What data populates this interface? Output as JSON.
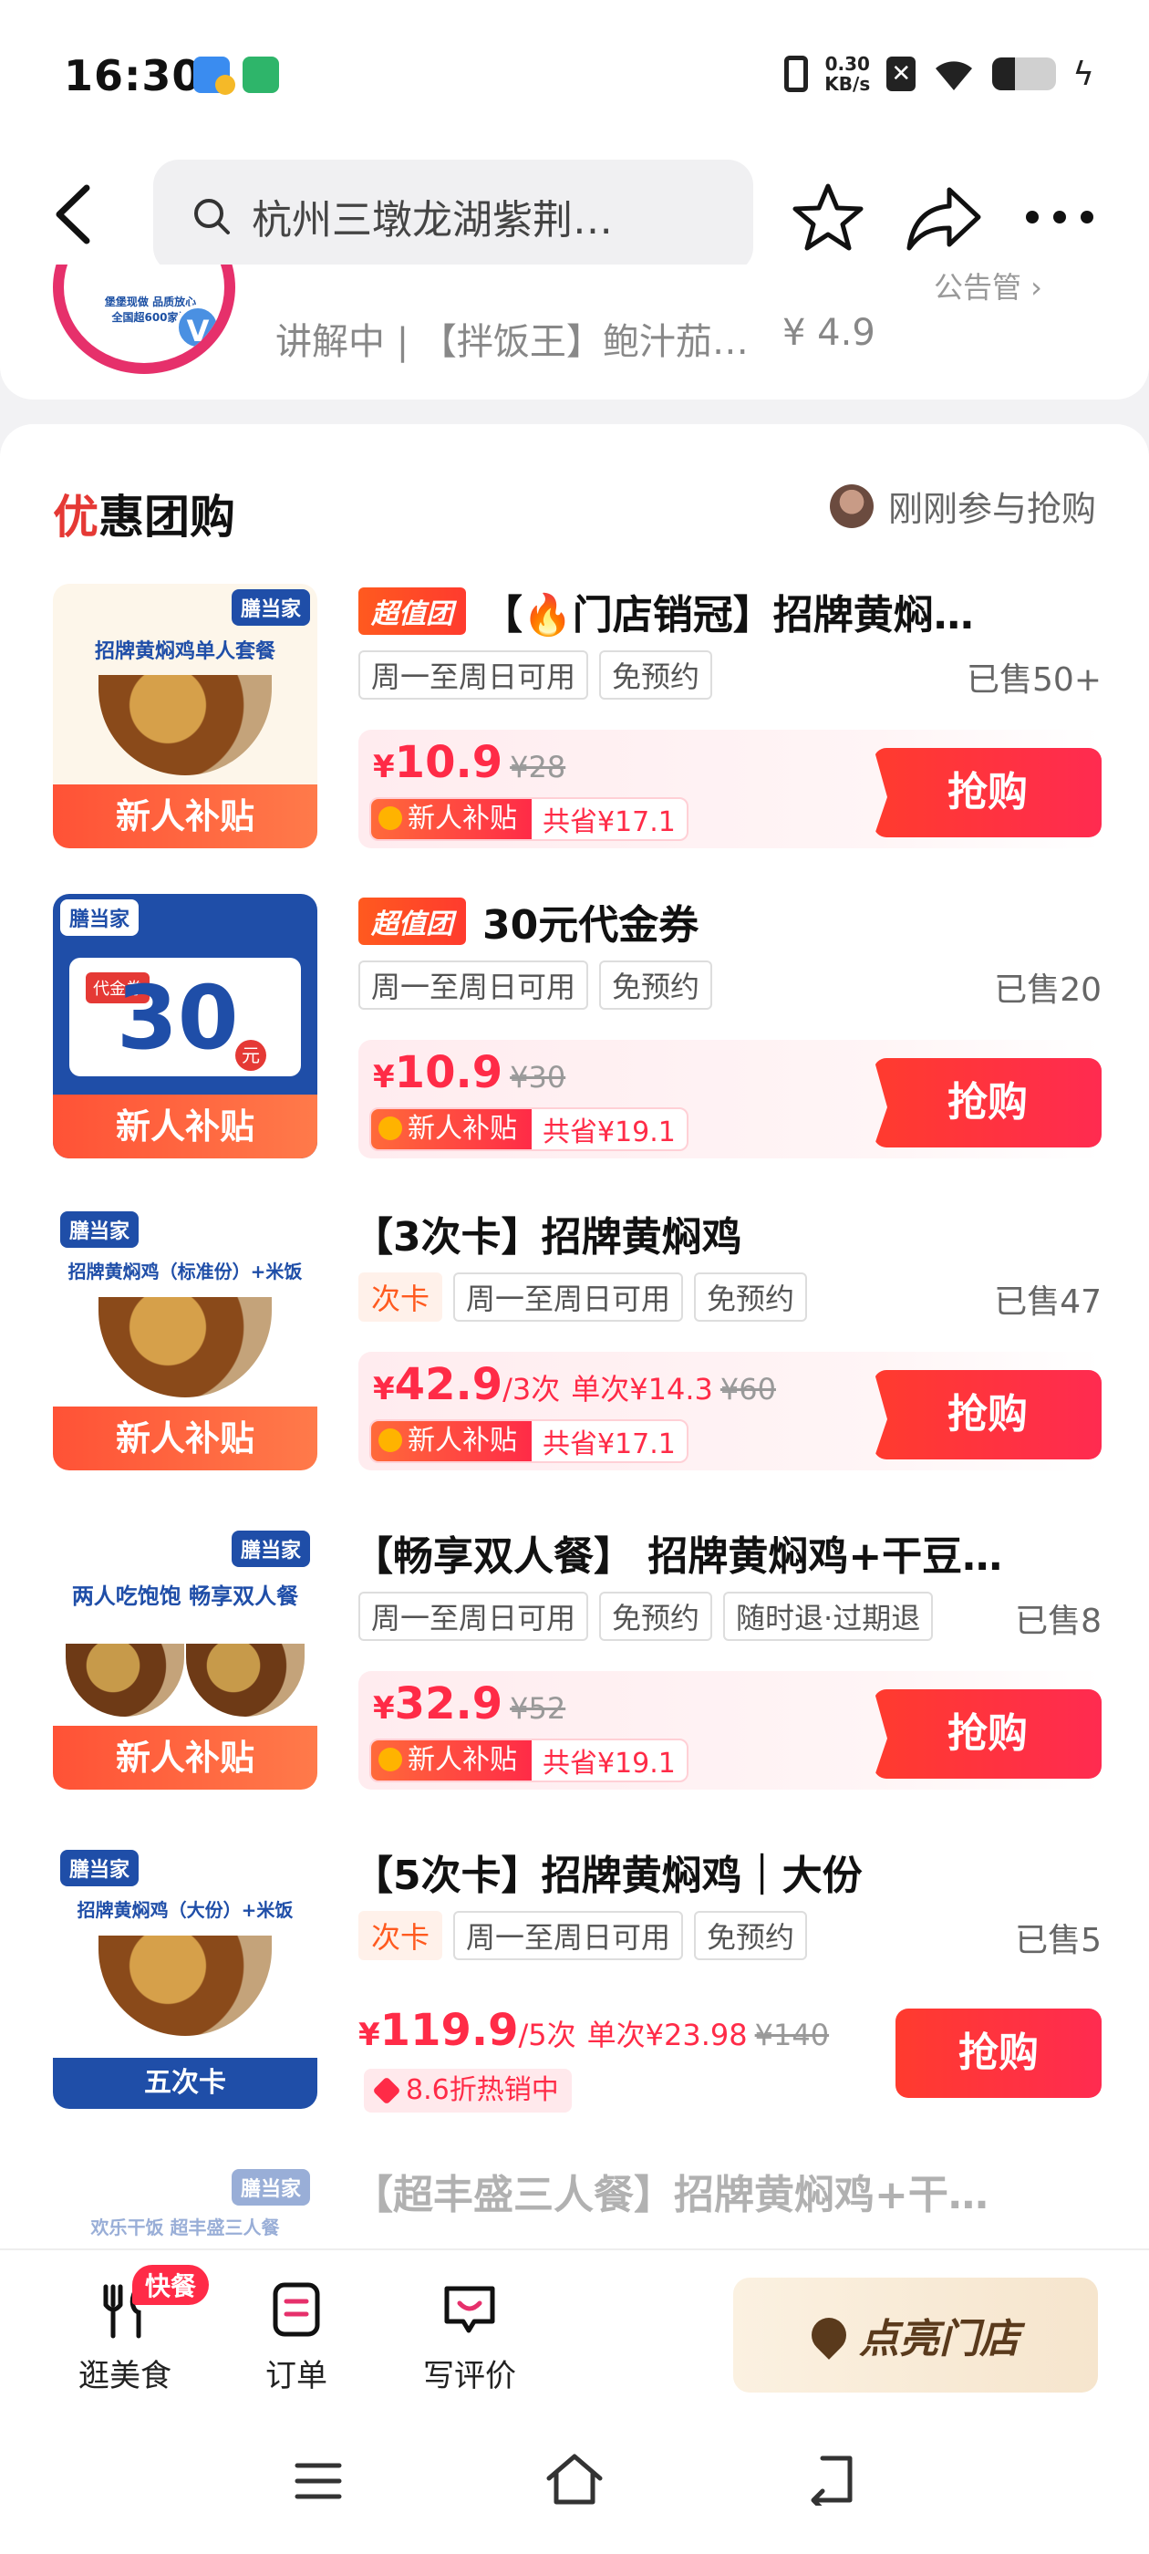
{
  "status": {
    "time": "16:30",
    "net_speed_top": "0.30",
    "net_speed_unit": "KB/s",
    "battery_level": 0.35
  },
  "search": {
    "text": "杭州三墩龙湖紫荆…"
  },
  "live": {
    "text": "讲解中 | 【拌饭王】鲍汁茄…",
    "price": "¥ 4.9",
    "corner": "公告管 ›",
    "logo_text": "堡堡现做 品质放心 全国超600家门"
  },
  "section": {
    "title_first": "优",
    "title_rest": "惠团购",
    "recent": "刚刚参与抢购"
  },
  "deals": [
    {
      "badge": "超值团",
      "title": "【🔥门店销冠】招牌黄焖…",
      "tags": [
        "周一至周日可用",
        "免预约"
      ],
      "sold": "已售50+",
      "yen": "¥",
      "price": "10.9",
      "unit": "",
      "per": "",
      "orig": "¥28",
      "subsidy_label": "新人补贴",
      "subsidy_save": "共省¥17.1",
      "thumb_brand": "膳当家",
      "thumb_line": "招牌黄焖鸡单人套餐",
      "thumb_band": "新人补贴",
      "buy": "抢购"
    },
    {
      "badge": "超值团",
      "title": "30元代金券",
      "tags": [
        "周一至周日可用",
        "免预约"
      ],
      "sold": "已售20",
      "yen": "¥",
      "price": "10.9",
      "unit": "",
      "per": "",
      "orig": "¥30",
      "subsidy_label": "新人补贴",
      "subsidy_save": "共省¥19.1",
      "thumb_brand": "膳当家",
      "thumb_num": "30",
      "thumb_tag": "代金券",
      "thumb_yuan": "元",
      "thumb_band": "新人补贴",
      "buy": "抢购"
    },
    {
      "ci": "次卡",
      "title": "【3次卡】招牌黄焖鸡",
      "tags": [
        "周一至周日可用",
        "免预约"
      ],
      "sold": "已售47",
      "yen": "¥",
      "price": "42.9",
      "unit": "/3次",
      "per": "单次¥14.3",
      "orig": "¥60",
      "subsidy_label": "新人补贴",
      "subsidy_save": "共省¥17.1",
      "thumb_brand": "膳当家",
      "thumb_line": "招牌黄焖鸡（标准份）+米饭",
      "thumb_band": "新人补贴",
      "buy": "抢购"
    },
    {
      "title": "【畅享双人餐】 招牌黄焖鸡+干豆…",
      "tags": [
        "周一至周日可用",
        "免预约",
        "随时退·过期退"
      ],
      "sold": "已售8",
      "yen": "¥",
      "price": "32.9",
      "unit": "",
      "per": "",
      "orig": "¥52",
      "subsidy_label": "新人补贴",
      "subsidy_save": "共省¥19.1",
      "thumb_brand": "膳当家",
      "thumb_line": "两人吃饱饱 畅享双人餐",
      "thumb_band": "新人补贴",
      "buy": "抢购"
    },
    {
      "ci": "次卡",
      "title": "【5次卡】招牌黄焖鸡｜大份",
      "tags": [
        "周一至周日可用",
        "免预约"
      ],
      "sold": "已售5",
      "yen": "¥",
      "price": "119.9",
      "unit": "/5次",
      "per": "单次¥23.98",
      "orig": "¥140",
      "discount": "8.6折热销中",
      "thumb_brand": "膳当家",
      "thumb_line": "招牌黄焖鸡（大份）+米饭",
      "thumb_band": "五次卡",
      "buy": "抢购"
    },
    {
      "title": "【超丰盛三人餐】招牌黄焖鸡+干…",
      "thumb_brand": "膳当家",
      "thumb_line": "欢乐干饭 超丰盛三人餐"
    }
  ],
  "bottom": {
    "tab_food": "逛美食",
    "tab_food_badge": "快餐",
    "tab_orders": "订单",
    "tab_review": "写评价",
    "light_store": "点亮门店"
  },
  "colors": {
    "accent": "#ff2b47",
    "brand_blue": "#1f4ea8"
  }
}
